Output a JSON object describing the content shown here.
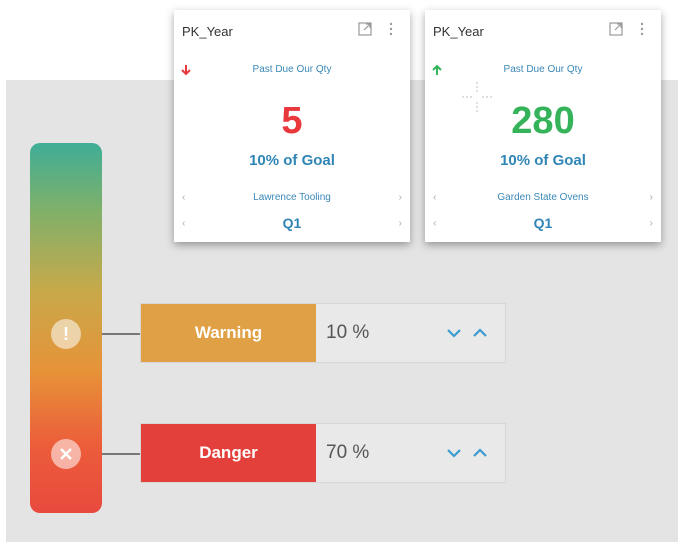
{
  "cards": [
    {
      "title": "PK_Year",
      "metric": "Past Due Our Qty",
      "value": "5",
      "value_color": "#e8383d",
      "trend": "down",
      "trend_color": "#e8383d",
      "goal_text": "10% of Goal",
      "entity": "Lawrence Tooling",
      "period": "Q1"
    },
    {
      "title": "PK_Year",
      "metric": "Past Due Our Qty",
      "value": "280",
      "value_color": "#35b35a",
      "trend": "up",
      "trend_color": "#35b35a",
      "goal_text": "10% of Goal",
      "entity": "Garden State Ovens",
      "period": "Q1"
    }
  ],
  "thresholds": [
    {
      "label": "Warning",
      "value": "10 %",
      "color": "#dfa046",
      "icon": "exclamation-icon"
    },
    {
      "label": "Danger",
      "value": "70 %",
      "color": "#e3403b",
      "icon": "close-circle-icon"
    }
  ],
  "colors": {
    "stepper": "#3b9bd0"
  }
}
